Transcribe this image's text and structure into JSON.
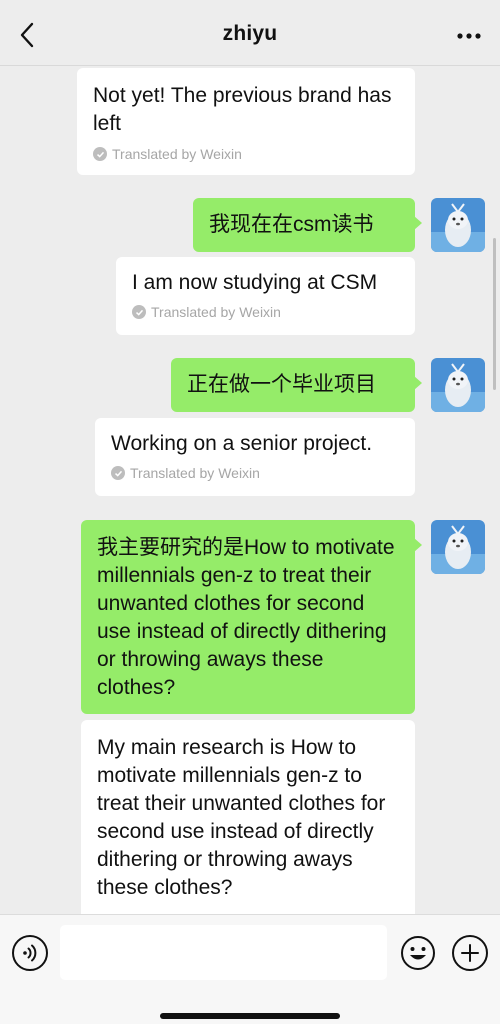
{
  "header": {
    "title": "zhiyu"
  },
  "messages": [
    {
      "side": "left",
      "text": "Not yet! The previous brand has left",
      "translation_note": "Translated by Weixin"
    },
    {
      "side": "right",
      "text": "我现在在csm读书"
    },
    {
      "side": "left",
      "text": "I am now studying at CSM",
      "translation_note": "Translated by Weixin"
    },
    {
      "side": "right",
      "text": "正在做一个毕业项目"
    },
    {
      "side": "left",
      "text": "Working on a senior project.",
      "translation_note": "Translated by Weixin"
    },
    {
      "side": "right",
      "text": "我主要研究的是How to motivate millennials gen-z to treat their unwanted clothes for second use instead of directly dithering or throwing aways these clothes?"
    },
    {
      "side": "left",
      "text": "My main research is How to motivate millennials gen-z to treat their unwanted clothes for second use instead of directly dithering or throwing aways these clothes?"
    }
  ],
  "input": {
    "value": "",
    "placeholder": ""
  },
  "icons": {
    "back": "chevron-left-icon",
    "more": "more-dots-icon",
    "voice": "voice-icon",
    "emoji": "emoji-icon",
    "plus": "plus-icon"
  },
  "colors": {
    "background": "#ededed",
    "sent_bubble": "#95ec69",
    "received_bubble": "#ffffff"
  }
}
